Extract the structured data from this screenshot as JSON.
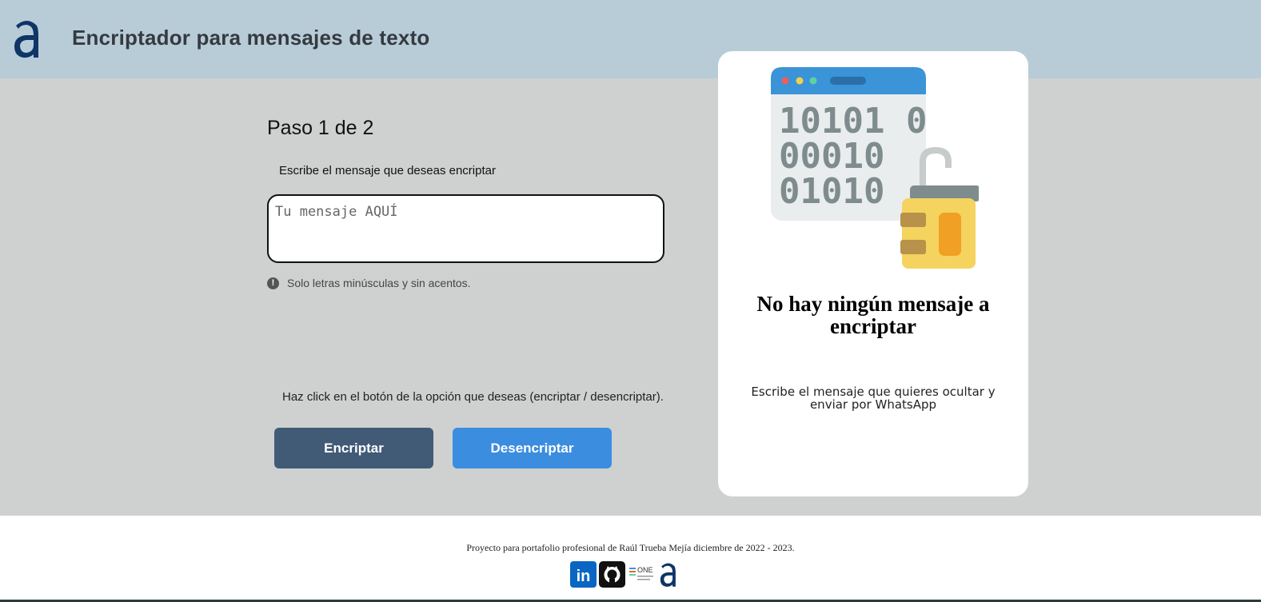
{
  "header": {
    "title": "Encriptador para mensajes de texto",
    "logo_icon": "alura-logo-icon",
    "background": "#b8ccd8"
  },
  "main": {
    "step_title": "Paso 1 de 2",
    "instruction": "Escribe el mensaje que deseas encriptar",
    "message_input": {
      "placeholder": "Tu mensaje AQUÍ",
      "value": ""
    },
    "hint": {
      "icon": "exclamation-circle-icon",
      "text": "Solo letras minúsculas y sin acentos."
    },
    "choose_text": "Haz click en el botón de la opción que deseas (encriptar / desencriptar).",
    "buttons": {
      "encrypt_label": "Encriptar",
      "decrypt_label": "Desencriptar"
    }
  },
  "result_card": {
    "illustration": "binary-padlock-icon",
    "binary_lines": [
      "10101 0",
      "00010",
      "01010"
    ],
    "title": "No hay ningún mensaje a encriptar",
    "description": "Escribe el mensaje que quieres ocultar y enviar por WhatsApp"
  },
  "footer": {
    "text": "Proyecto para portafolio profesional de Raúl Trueba Mejía diciembre de 2022 - 2023.",
    "links": [
      {
        "icon": "linkedin-icon",
        "label": "in"
      },
      {
        "icon": "github-icon"
      },
      {
        "icon": "oracle-one-icon",
        "label": "ONE"
      },
      {
        "icon": "alura-logo-icon"
      }
    ]
  },
  "colors": {
    "page_bg": "#cfd1d1",
    "encrypt_button": "#415b77",
    "decrypt_button": "#3b8de0",
    "card_bg": "#ffffff"
  }
}
